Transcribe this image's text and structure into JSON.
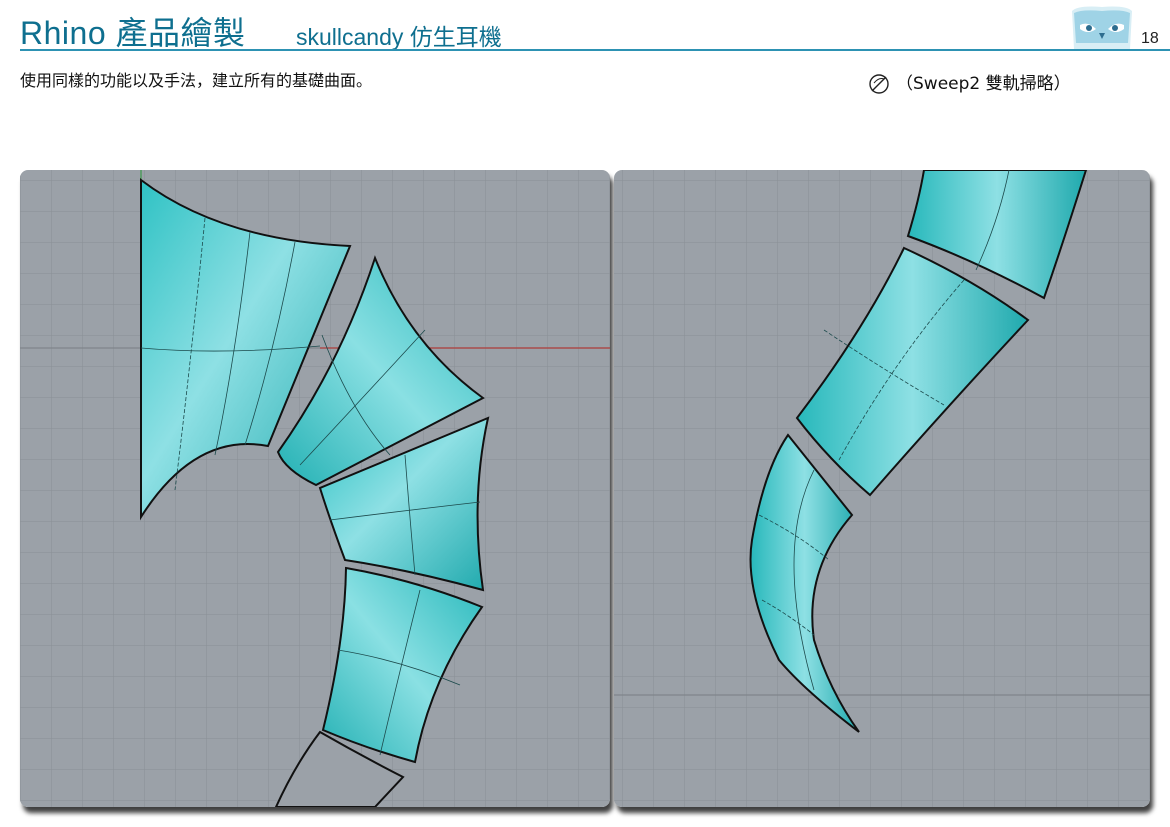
{
  "header": {
    "title": "Rhino 產品繪製",
    "subtitle": "skullcandy 仿生耳機",
    "page_number": "18",
    "logo_icon": "owl-logo-icon"
  },
  "instruction": {
    "text": "使用同樣的功能以及手法，建立所有的基礎曲面。"
  },
  "command": {
    "icon": "sweep2-icon",
    "label": "（Sweep2 雙軌掃略）"
  },
  "colors": {
    "title": "#0e6f8f",
    "rule": "#2d92b3",
    "viewport_bg": "#9ba1a8",
    "grid": "#8a9096",
    "surface": "#2fc2c4",
    "surface_light": "#8ee0e4",
    "x_axis": "#b0403c"
  },
  "viewports": [
    {
      "name": "left-viewport",
      "content": "five lofted surface segments arranged in a curve"
    },
    {
      "name": "right-viewport",
      "content": "three tapered surface segments forming a tail"
    }
  ]
}
